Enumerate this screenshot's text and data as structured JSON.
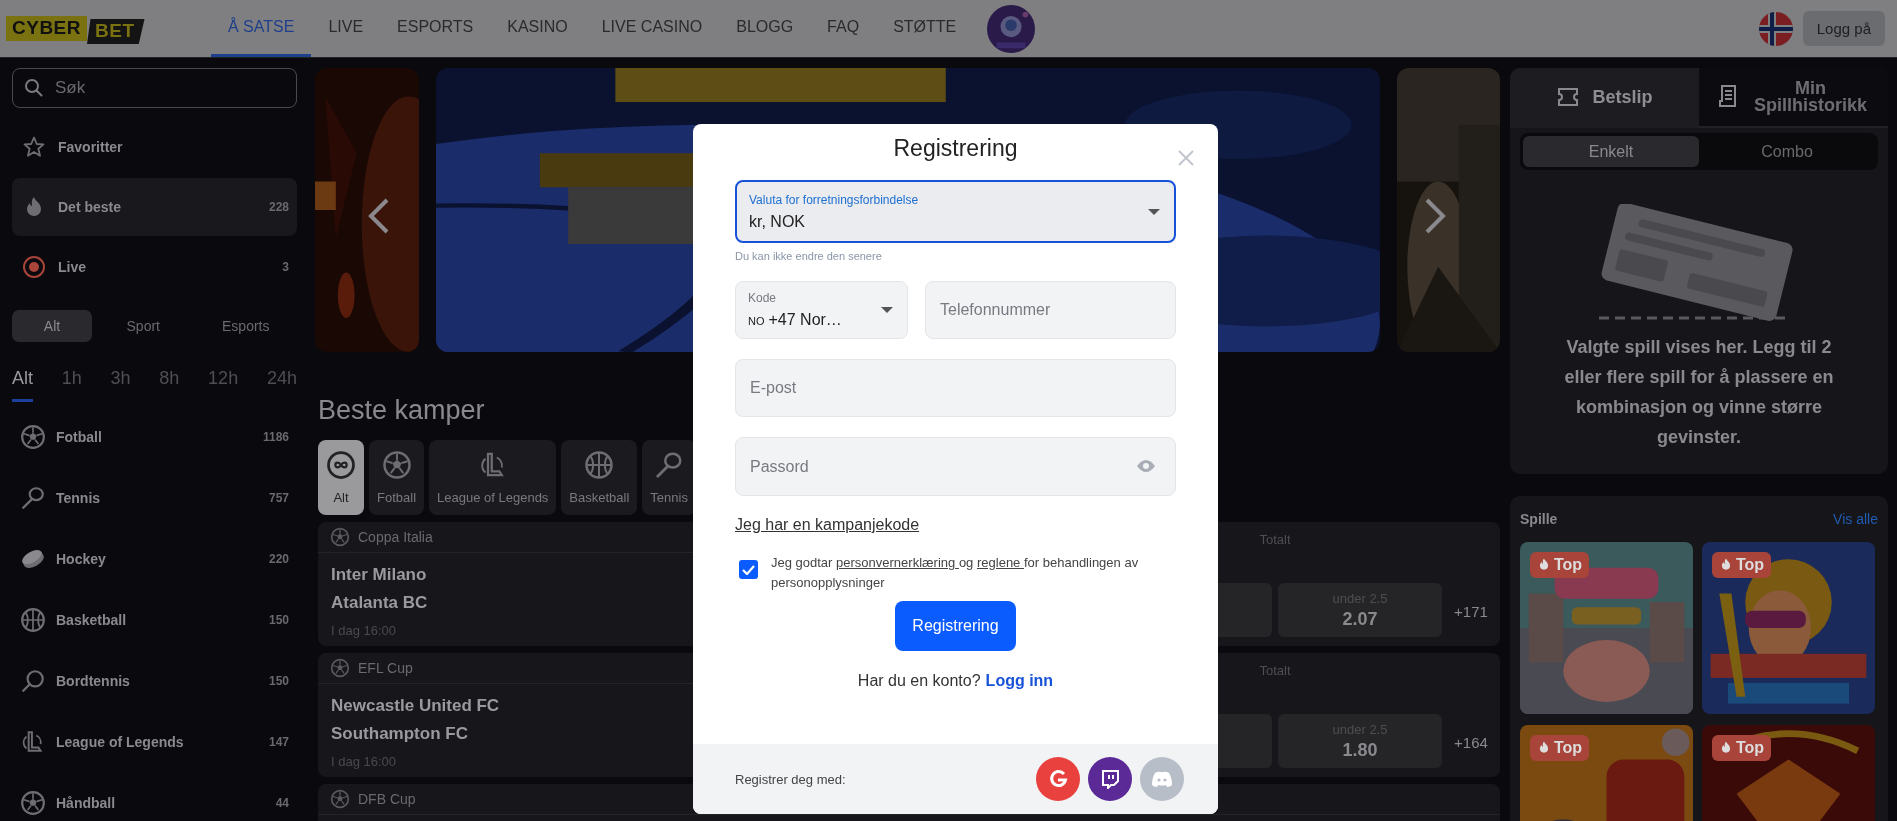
{
  "header": {
    "logo": {
      "part_1": "CYBER",
      "part_2": "BET"
    },
    "nav": [
      {
        "label": "Å SATSE",
        "selected": true
      },
      {
        "label": "LIVE",
        "selected": false
      },
      {
        "label": "ESPORTS",
        "selected": false
      },
      {
        "label": "KASINO",
        "selected": false
      },
      {
        "label": "LIVE CASINO",
        "selected": false
      },
      {
        "label": "BLOGG",
        "selected": false
      },
      {
        "label": "FAQ",
        "selected": false
      },
      {
        "label": "STØTTE",
        "selected": false
      }
    ],
    "login_button": "Logg på"
  },
  "sidebar": {
    "search": {
      "placeholder": "Søk"
    },
    "quick_links": [
      {
        "label": "Favoritter",
        "selected": false
      },
      {
        "label": "Det beste",
        "count": "228",
        "selected": true
      },
      {
        "label": "Live",
        "count": "3",
        "selected": false
      }
    ],
    "type_tabs": [
      {
        "label": "Alt",
        "selected": true
      },
      {
        "label": "Sport",
        "selected": false
      },
      {
        "label": "Esports",
        "selected": false
      }
    ],
    "time_tabs": [
      {
        "label": "Alt",
        "selected": true
      },
      {
        "label": "1h",
        "selected": false
      },
      {
        "label": "3h",
        "selected": false
      },
      {
        "label": "8h",
        "selected": false
      },
      {
        "label": "12h",
        "selected": false
      },
      {
        "label": "24h",
        "selected": false
      }
    ],
    "sports": [
      {
        "name": "Fotball",
        "count": "1186"
      },
      {
        "name": "Tennis",
        "count": "757"
      },
      {
        "name": "Hockey",
        "count": "220"
      },
      {
        "name": "Basketball",
        "count": "150"
      },
      {
        "name": "Bordtennis",
        "count": "150"
      },
      {
        "name": "League of Legends",
        "count": "147"
      },
      {
        "name": "Håndball",
        "count": "44"
      }
    ]
  },
  "main": {
    "heading": "Beste kamper",
    "filters": [
      {
        "label": "Alt",
        "selected": true
      },
      {
        "label": "Fotball",
        "selected": false
      },
      {
        "label": "League of Legends",
        "selected": false
      },
      {
        "label": "Basketball",
        "selected": false
      },
      {
        "label": "Tennis",
        "selected": false
      }
    ],
    "matches": [
      {
        "league": "Coppa Italia",
        "home": "Inter Milano",
        "away": "Atalanta BC",
        "time": "I dag 16:00",
        "market": "Totalt",
        "odds_label": "under 2.5",
        "odds_value": "2.07",
        "more": "+171"
      },
      {
        "league": "EFL Cup",
        "home": "Newcastle United FC",
        "away": "Southampton FC",
        "time": "I dag 16:00",
        "market": "Totalt",
        "odds_label": "under 2.5",
        "odds_value": "1.80",
        "more": "+164"
      },
      {
        "league": "DFB Cup"
      }
    ]
  },
  "betslip": {
    "tabs": [
      {
        "label": "Betslip",
        "selected": true
      },
      {
        "label": "Min Spillhistorikk",
        "selected": false
      }
    ],
    "modes": [
      {
        "label": "Enkelt",
        "selected": true
      },
      {
        "label": "Combo",
        "selected": false
      }
    ],
    "empty_text": "Valgte spill vises her. Legg til 2 eller flere spill for å plassere en kombinasjon og vinne større gevinster."
  },
  "games": {
    "title": "Spille",
    "link": "Vis alle",
    "items": [
      {
        "badge": "Top"
      },
      {
        "badge": "Top"
      },
      {
        "badge": "Top"
      },
      {
        "badge": "Top"
      }
    ]
  },
  "modal": {
    "title": "Registrering",
    "currency": {
      "label": "Valuta for forretningsforbindelse",
      "value": "kr, NOK",
      "focused": true
    },
    "helper": "Du kan ikke endre den senere",
    "code": {
      "label": "Kode",
      "flag": "NO",
      "value": "+47 Nor…"
    },
    "phone": {
      "placeholder": "Telefonnummer"
    },
    "email": {
      "placeholder": "E-post"
    },
    "password": {
      "placeholder": "Passord"
    },
    "promo_link": "Jeg har en kampanjekode",
    "consent": {
      "checked": true,
      "parts": [
        {
          "text": "Jeg godtar "
        },
        {
          "text": "personvernerklæring ",
          "kind": "link"
        },
        {
          "text": "og "
        },
        {
          "text": "reglene ",
          "kind": "link"
        },
        {
          "text": "for behandlingen av personopplysninger"
        }
      ]
    },
    "submit": "Registrering",
    "login_prompt": "Har du en konto?",
    "login_link": "Logg inn",
    "social_label": "Registrer deg med:"
  }
}
